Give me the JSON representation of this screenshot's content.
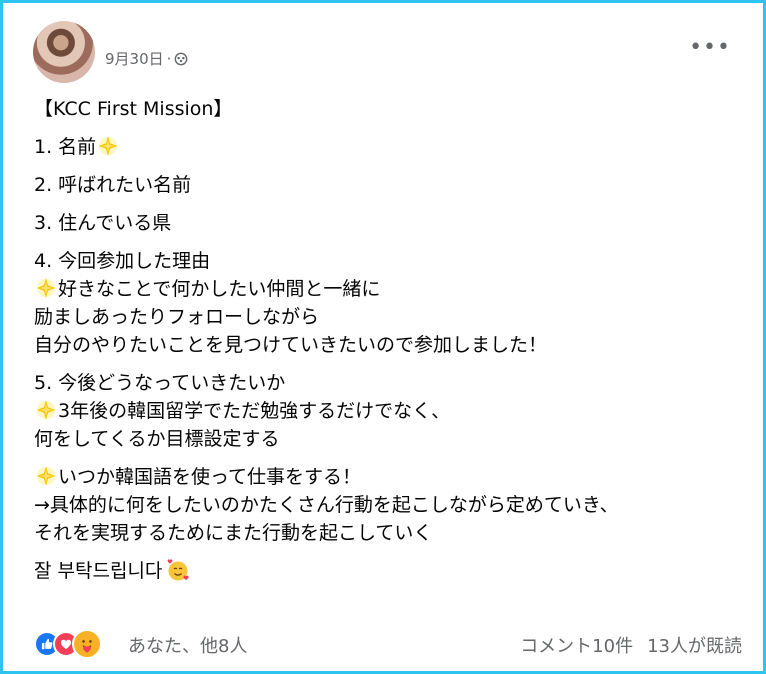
{
  "post": {
    "date": "9月30日",
    "separator": "·",
    "privacy_icon": "group-icon",
    "more_icon": "more-dots-icon",
    "more_label": "•••",
    "lines": [
      {
        "text": "【KCC First Mission】"
      },
      {
        "gap": true
      },
      {
        "text": "1. 名前",
        "emoji_after": "sparkle"
      },
      {
        "gap": true
      },
      {
        "text": "2. 呼ばれたい名前"
      },
      {
        "gap": true
      },
      {
        "text": "3. 住んでいる県"
      },
      {
        "gap": true
      },
      {
        "text": "4. 今回参加した理由"
      },
      {
        "text": "好きなことで何かしたい仲間と一緒に",
        "emoji_before": "sparkle"
      },
      {
        "text": "励ましあったりフォローしながら"
      },
      {
        "text": "自分のやりたいことを見つけていきたいので参加しました！"
      },
      {
        "gap": true
      },
      {
        "text": "5. 今後どうなっていきたいか"
      },
      {
        "text": "3年後の韓国留学でただ勉強するだけでなく、",
        "emoji_before": "sparkle"
      },
      {
        "text": "何をしてくるか目標設定する"
      },
      {
        "gap": true
      },
      {
        "text": "いつか韓国語を使って仕事をする！",
        "emoji_before": "sparkle"
      },
      {
        "text": "→具体的に何をしたいのかたくさん行動を起こしながら定めていき、"
      },
      {
        "text": "それを実現するためにまた行動を起こしていく"
      },
      {
        "gap": true
      },
      {
        "text": "잘 부탁드립니다",
        "emoji_after": "smiling-face-with-hearts"
      }
    ]
  },
  "footer": {
    "reaction_icons": [
      "like-icon",
      "love-icon",
      "care-icon"
    ],
    "reactors": "あなた、他8人",
    "comments": "コメント10件",
    "seen": "13人が既読"
  },
  "colors": {
    "border": "#2ec4f0",
    "text": "#050505",
    "secondary": "#65676b",
    "like": "#1877f2",
    "love": "#f33e58",
    "care": "#f7b125"
  }
}
